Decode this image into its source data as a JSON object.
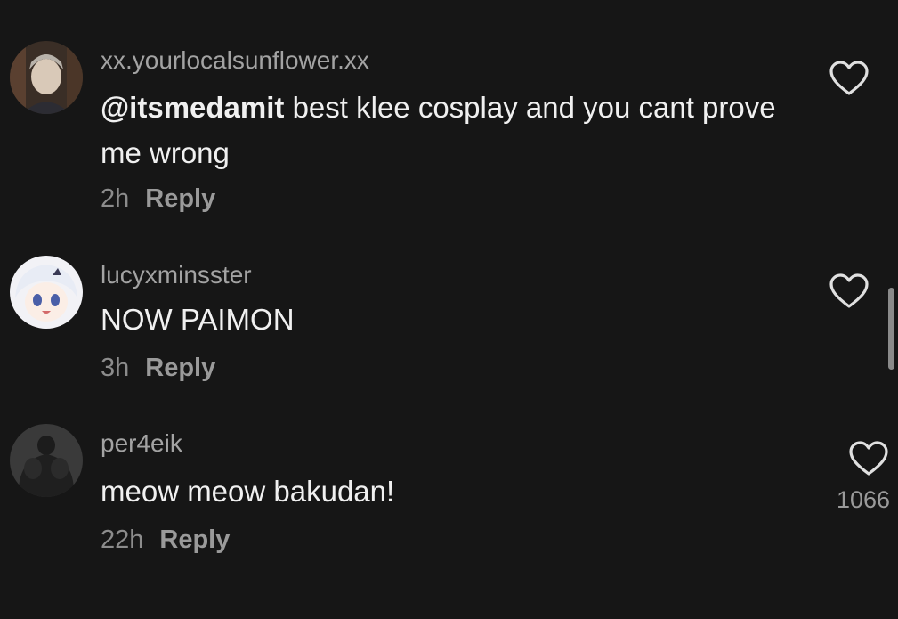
{
  "comments": [
    {
      "username": "xx.yourlocalsunflower.xx",
      "mention": "@itsmedamit",
      "text": " best klee cosplay and you cant prove me wrong",
      "time": "2h",
      "reply_label": "Reply",
      "likes": ""
    },
    {
      "username": "lucyxminsster",
      "mention": "",
      "text": "NOW PAIMON",
      "time": "3h",
      "reply_label": "Reply",
      "likes": ""
    },
    {
      "username": "per4eik",
      "mention": "",
      "text": "meow meow bakudan!",
      "time": "22h",
      "reply_label": "Reply",
      "likes": "1066"
    }
  ],
  "icons": {
    "like": "heart-outline-icon"
  },
  "colors": {
    "background": "#161616",
    "username": "#a3a3a3",
    "text": "#f0f0f0",
    "meta": "#8c8c8c"
  }
}
